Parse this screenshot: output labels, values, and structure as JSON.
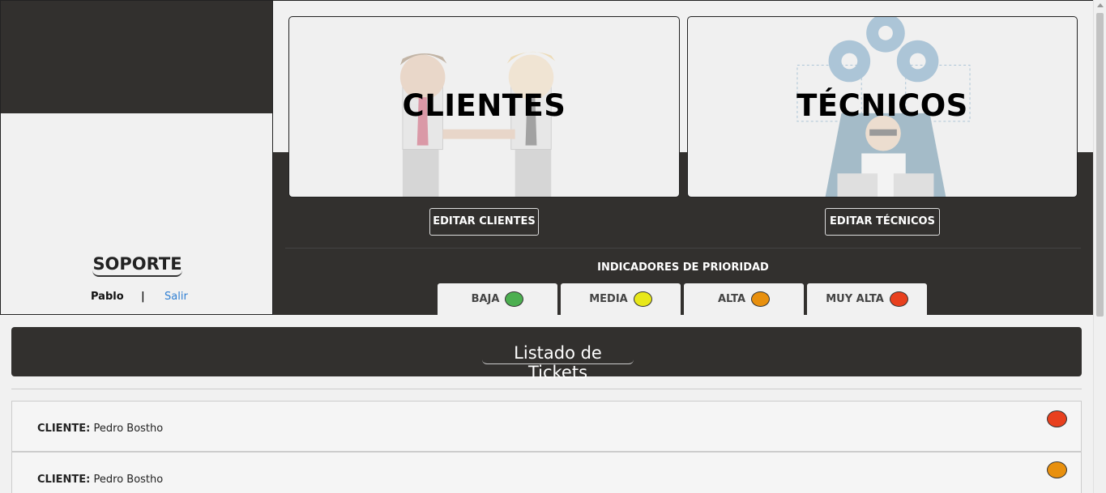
{
  "sidebar": {
    "title": "SOPORTE",
    "user_name": "Pablo",
    "separator": "|",
    "logout_label": "Salir"
  },
  "cards": {
    "clientes_title": "CLIENTES",
    "tecnicos_title": "TÉCNICOS",
    "edit_clientes_label": "EDITAR CLIENTES",
    "edit_tecnicos_label": "EDITAR TÉCNICOS"
  },
  "priority": {
    "title": "INDICADORES DE PRIORIDAD",
    "levels": [
      {
        "label": "BAJA",
        "color": "#4caf50"
      },
      {
        "label": "MEDIA",
        "color": "#e8e81a"
      },
      {
        "label": "ALTA",
        "color": "#e8900e"
      },
      {
        "label": "MUY ALTA",
        "color": "#e8401e"
      }
    ]
  },
  "tickets": {
    "title": "Listado de Tickets",
    "items": [
      {
        "label": "CLIENTE:",
        "value": "Pedro Bostho",
        "color": "#e8401e"
      },
      {
        "label": "CLIENTE:",
        "value": "Pedro Bostho",
        "color": "#e8900e"
      }
    ]
  }
}
